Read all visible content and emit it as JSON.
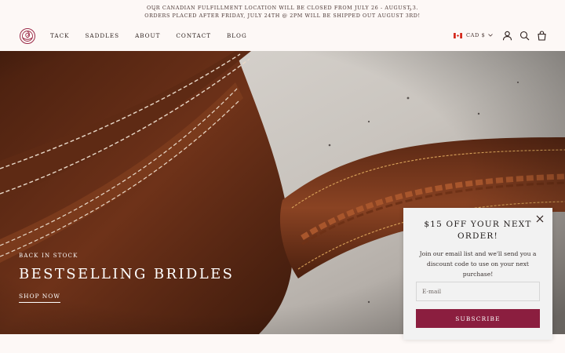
{
  "announcement": {
    "line1": "OUR CANADIAN FULFILLMENT LOCATION WILL BE CLOSED FROM JULY 26 - AUGUST 3.",
    "line2": "ORDERS PLACED AFTER FRIDAY, JULY 24TH @ 2PM WILL BE SHIPPED OUT AUGUST 3RD!",
    "prev_icon": "chevron-left-icon",
    "next_icon": "chevron-right-icon"
  },
  "header": {
    "logo_icon": "rose-logo-icon",
    "nav": [
      "TACK",
      "SADDLES",
      "ABOUT",
      "CONTACT",
      "BLOG"
    ],
    "currency": "CAD $",
    "icons": [
      "account-icon",
      "search-icon",
      "cart-icon"
    ]
  },
  "hero": {
    "eyebrow": "BACK IN STOCK",
    "title": "BESTSELLING BRIDLES",
    "link": "SHOP NOW"
  },
  "popup": {
    "heading": "$15 OFF YOUR NEXT ORDER!",
    "text": "Join our email list and we'll send you a discount code to use on your next purchase!",
    "email_placeholder": "E-mail",
    "email_value": "",
    "button": "SUBSCRIBE"
  },
  "colors": {
    "background": "#fdf8f6",
    "accent": "#8b1e3f",
    "popup_background": "#f2f2f2",
    "leather": "#6b2f18"
  }
}
